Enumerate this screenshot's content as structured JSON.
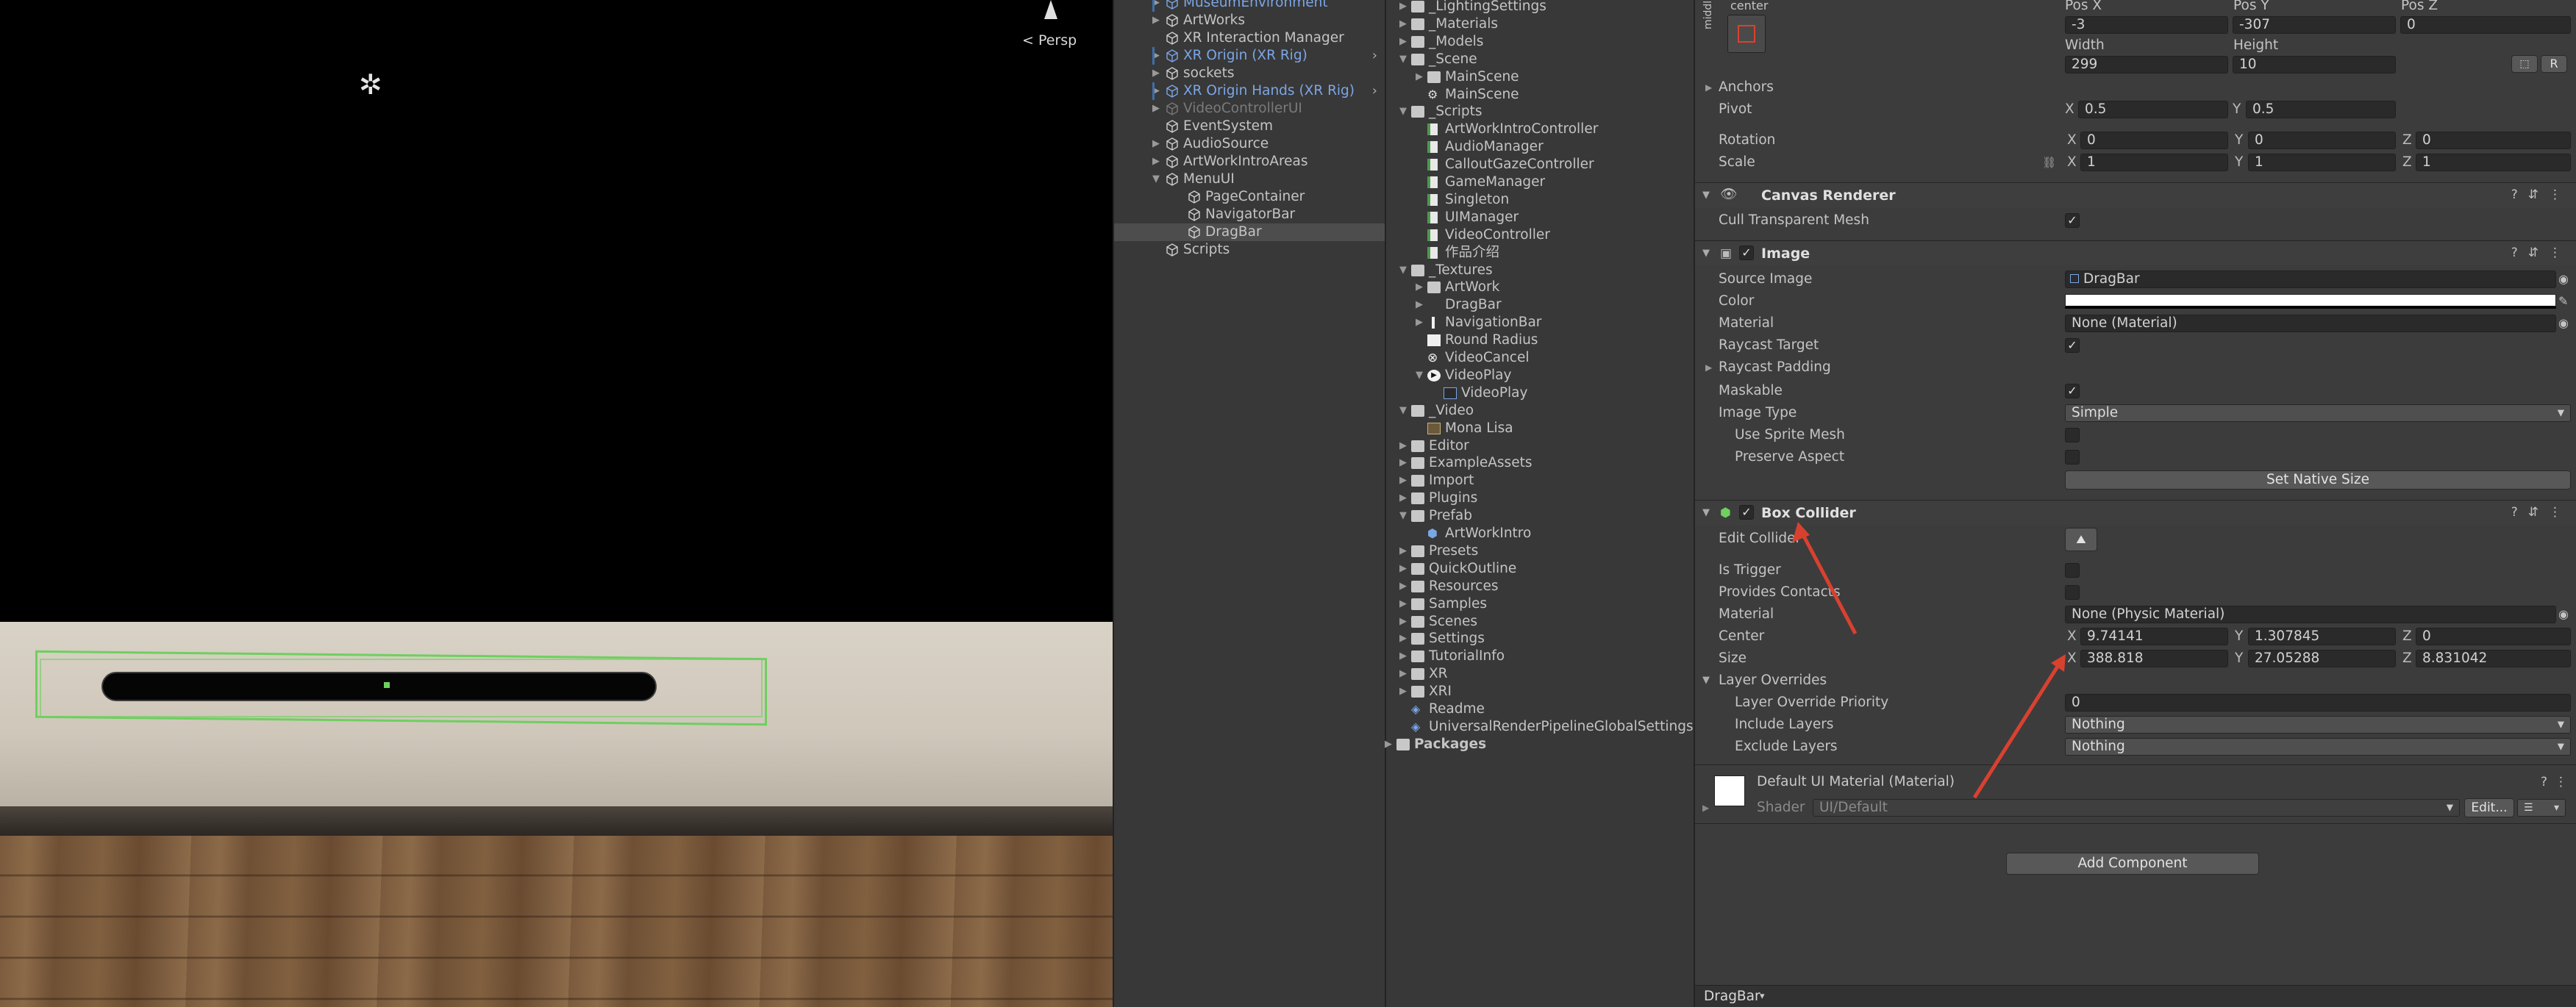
{
  "scene": {
    "persp_label": "< Persp"
  },
  "hierarchy": {
    "items": [
      {
        "label": "MuseumEnvironment",
        "style": "blue"
      },
      {
        "label": "ArtWorks",
        "style": "normal"
      },
      {
        "label": "XR Interaction Manager",
        "style": "normal"
      },
      {
        "label": "XR Origin (XR Rig)",
        "style": "blue"
      },
      {
        "label": "sockets",
        "style": "normal"
      },
      {
        "label": "XR Origin Hands (XR Rig)",
        "style": "blue"
      },
      {
        "label": "VideoControllerUI",
        "style": "dim"
      },
      {
        "label": "EventSystem",
        "style": "normal"
      },
      {
        "label": "AudioSource",
        "style": "normal"
      },
      {
        "label": "ArtWorkIntroAreas",
        "style": "normal"
      },
      {
        "label": "MenuUI",
        "style": "normal"
      },
      {
        "label": "PageContainer",
        "style": "normal"
      },
      {
        "label": "NavigatorBar",
        "style": "normal"
      },
      {
        "label": "DragBar",
        "style": "selected"
      },
      {
        "label": "Scripts",
        "style": "normal"
      }
    ]
  },
  "project": {
    "items": [
      {
        "label": "_LightingSettings",
        "type": "folder"
      },
      {
        "label": "_Materials",
        "type": "folder"
      },
      {
        "label": "_Models",
        "type": "folder"
      },
      {
        "label": "_Scene",
        "type": "folder"
      },
      {
        "label": "MainScene",
        "type": "folder"
      },
      {
        "label": "MainScene",
        "type": "scene"
      },
      {
        "label": "_Scripts",
        "type": "folder"
      },
      {
        "label": "ArtWorkIntroController",
        "type": "script"
      },
      {
        "label": "AudioManager",
        "type": "script"
      },
      {
        "label": "CalloutGazeController",
        "type": "script"
      },
      {
        "label": "GameManager",
        "type": "script"
      },
      {
        "label": "Singleton",
        "type": "script"
      },
      {
        "label": "UIManager",
        "type": "script"
      },
      {
        "label": "VideoController",
        "type": "script"
      },
      {
        "label": "作品介绍",
        "type": "script"
      },
      {
        "label": "_Textures",
        "type": "folder"
      },
      {
        "label": "ArtWork",
        "type": "folder"
      },
      {
        "label": "DragBar",
        "type": "texture"
      },
      {
        "label": "NavigationBar",
        "type": "texture"
      },
      {
        "label": "Round Radius",
        "type": "texture"
      },
      {
        "label": "VideoCancel",
        "type": "texture"
      },
      {
        "label": "VideoPlay",
        "type": "texture"
      },
      {
        "label": "VideoPlay",
        "type": "sprite"
      },
      {
        "label": "_Video",
        "type": "folder"
      },
      {
        "label": "Mona Lisa",
        "type": "video"
      },
      {
        "label": "Editor",
        "type": "folder"
      },
      {
        "label": "ExampleAssets",
        "type": "folder"
      },
      {
        "label": "Import",
        "type": "folder"
      },
      {
        "label": "Plugins",
        "type": "folder"
      },
      {
        "label": "Prefab",
        "type": "folder"
      },
      {
        "label": "ArtWorkIntro",
        "type": "prefab"
      },
      {
        "label": "Presets",
        "type": "folder"
      },
      {
        "label": "QuickOutline",
        "type": "folder"
      },
      {
        "label": "Resources",
        "type": "folder"
      },
      {
        "label": "Samples",
        "type": "folder"
      },
      {
        "label": "Scenes",
        "type": "folder"
      },
      {
        "label": "Settings",
        "type": "folder"
      },
      {
        "label": "TutorialInfo",
        "type": "folder"
      },
      {
        "label": "XR",
        "type": "folder"
      },
      {
        "label": "XRI",
        "type": "folder"
      },
      {
        "label": "Readme",
        "type": "asset"
      },
      {
        "label": "UniversalRenderPipelineGlobalSettings",
        "type": "asset"
      },
      {
        "label": "Packages",
        "type": "folder"
      }
    ]
  },
  "inspector": {
    "rect": {
      "anchor_label": "center",
      "anchor_v_label": "middle",
      "posx_label": "Pos X",
      "posy_label": "Pos Y",
      "posz_label": "Pos Z",
      "posx": "-3",
      "posy": "-307",
      "posz": "0",
      "width_label": "Width",
      "height_label": "Height",
      "width": "299",
      "height": "10",
      "r_button": "R",
      "anchors_label": "Anchors",
      "pivot_label": "Pivot",
      "pivot_x": "0.5",
      "pivot_y": "0.5",
      "rotation_label": "Rotation",
      "rot_x": "0",
      "rot_y": "0",
      "rot_z": "0",
      "scale_label": "Scale",
      "scale_x": "1",
      "scale_y": "1",
      "scale_z": "1"
    },
    "axes": {
      "x": "X",
      "y": "Y",
      "z": "Z"
    },
    "canvas_renderer": {
      "title": "Canvas Renderer",
      "cull_label": "Cull Transparent Mesh"
    },
    "image": {
      "title": "Image",
      "source_image_label": "Source Image",
      "source_image": "DragBar",
      "color_label": "Color",
      "color_value": "#ffffff",
      "material_label": "Material",
      "material": "None (Material)",
      "raycast_target_label": "Raycast Target",
      "raycast_padding_label": "Raycast Padding",
      "maskable_label": "Maskable",
      "image_type_label": "Image Type",
      "image_type": "Simple",
      "use_sprite_mesh_label": "Use Sprite Mesh",
      "preserve_aspect_label": "Preserve Aspect",
      "set_native_size": "Set Native Size"
    },
    "box_collider": {
      "title": "Box Collider",
      "edit_collider_label": "Edit Collider",
      "is_trigger_label": "Is Trigger",
      "provides_contacts_label": "Provides Contacts",
      "material_label": "Material",
      "material": "None (Physic Material)",
      "center_label": "Center",
      "center_x": "9.74141",
      "center_y": "1.307845",
      "center_z": "0",
      "size_label": "Size",
      "size_x": "388.818",
      "size_y": "27.05288",
      "size_z": "8.831042",
      "layer_overrides_label": "Layer Overrides",
      "layer_priority_label": "Layer Override Priority",
      "layer_priority": "0",
      "include_layers_label": "Include Layers",
      "include_layers": "Nothing",
      "exclude_layers_label": "Exclude Layers",
      "exclude_layers": "Nothing"
    },
    "material_section": {
      "title": "Default UI Material (Material)",
      "shader_label": "Shader",
      "shader": "UI/Default",
      "edit_button": "Edit..."
    },
    "add_component": "Add Component",
    "bottom_label": "DragBar"
  },
  "colors": {
    "accent_blue": "#7ba6e6",
    "collider_green": "#6fcf5f",
    "annotation_red": "#d9412f"
  }
}
